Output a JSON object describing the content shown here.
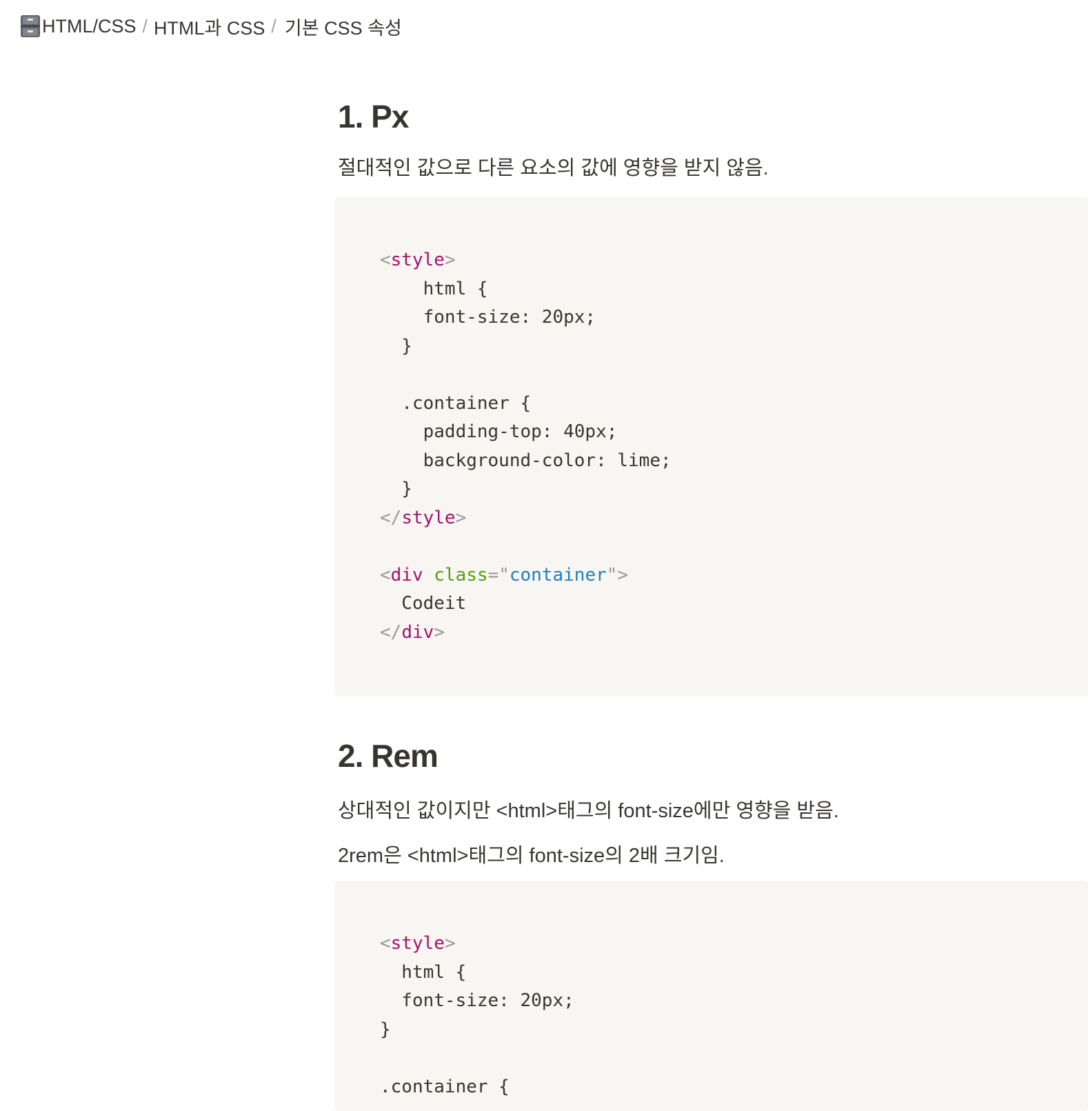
{
  "breadcrumb": {
    "icon": "file-cabinet-icon",
    "items": [
      "HTML/CSS",
      "HTML과 CSS",
      "기본 CSS 속성"
    ],
    "separator": "/"
  },
  "sections": [
    {
      "heading": "1. Px",
      "paragraphs": [
        "절대적인 값으로 다른 요소의 값에 영향을 받지 않음."
      ],
      "code_lines": [
        [
          {
            "t": "<",
            "c": "punct"
          },
          {
            "t": "style",
            "c": "tag"
          },
          {
            "t": ">",
            "c": "punct"
          }
        ],
        [
          {
            "t": "    html {",
            "c": "plain"
          }
        ],
        [
          {
            "t": "    font-size: 20px;",
            "c": "plain"
          }
        ],
        [
          {
            "t": "  }",
            "c": "plain"
          }
        ],
        [],
        [
          {
            "t": "  .container {",
            "c": "plain"
          }
        ],
        [
          {
            "t": "    padding-top: 40px;",
            "c": "plain"
          }
        ],
        [
          {
            "t": "    background-color: lime;",
            "c": "plain"
          }
        ],
        [
          {
            "t": "  }",
            "c": "plain"
          }
        ],
        [
          {
            "t": "</",
            "c": "punct"
          },
          {
            "t": "style",
            "c": "tag"
          },
          {
            "t": ">",
            "c": "punct"
          }
        ],
        [],
        [
          {
            "t": "<",
            "c": "punct"
          },
          {
            "t": "div",
            "c": "tag"
          },
          {
            "t": " ",
            "c": "plain"
          },
          {
            "t": "class",
            "c": "attr"
          },
          {
            "t": "=\"",
            "c": "punct"
          },
          {
            "t": "container",
            "c": "str"
          },
          {
            "t": "\">",
            "c": "punct"
          }
        ],
        [
          {
            "t": "  Codeit",
            "c": "plain"
          }
        ],
        [
          {
            "t": "</",
            "c": "punct"
          },
          {
            "t": "div",
            "c": "tag"
          },
          {
            "t": ">",
            "c": "punct"
          }
        ]
      ]
    },
    {
      "heading": "2. Rem",
      "paragraphs": [
        "상대적인 값이지만 <html>태그의 font-size에만 영향을 받음.",
        "2rem은 <html>태그의 font-size의 2배 크기임."
      ],
      "code_lines": [
        [
          {
            "t": "<",
            "c": "punct"
          },
          {
            "t": "style",
            "c": "tag"
          },
          {
            "t": ">",
            "c": "punct"
          }
        ],
        [
          {
            "t": "  html {",
            "c": "plain"
          }
        ],
        [
          {
            "t": "  font-size: 20px;",
            "c": "plain"
          }
        ],
        [
          {
            "t": "}",
            "c": "plain"
          }
        ],
        [],
        [
          {
            "t": ".container {",
            "c": "plain"
          }
        ]
      ]
    }
  ],
  "colors": {
    "text": "#37352f",
    "code_background": "#f7f6f3",
    "tag": "#a5126b",
    "attribute": "#5a9b10",
    "string": "#1e7fb6",
    "punctuation": "#999999"
  }
}
